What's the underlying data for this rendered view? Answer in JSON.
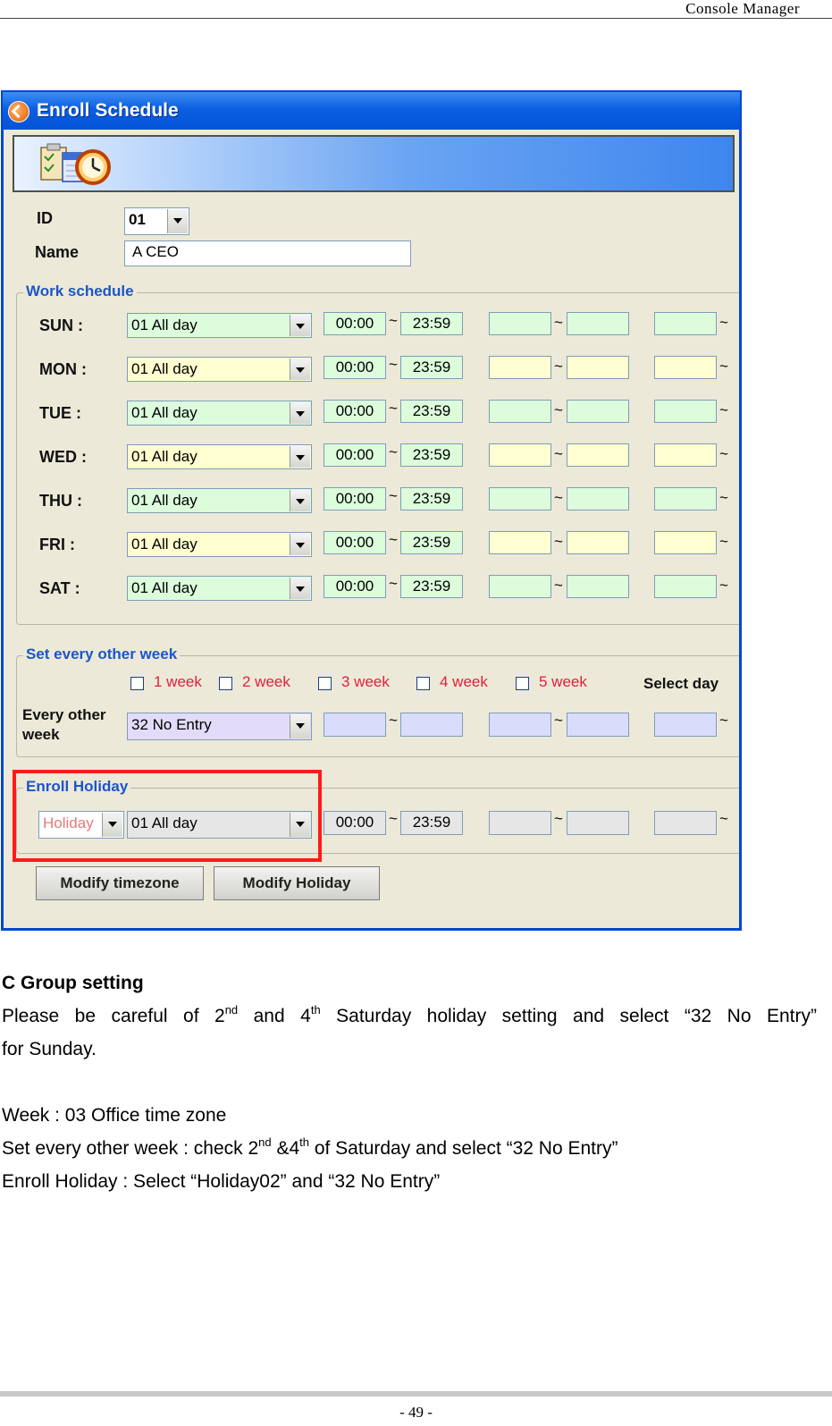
{
  "page_header": "Console Manager",
  "page_number": "- 49 -",
  "window": {
    "title": "Enroll Schedule",
    "id_label": "ID",
    "id_value": "01",
    "name_label": "Name",
    "name_value": "A CEO",
    "work_schedule": {
      "title": "Work schedule",
      "rows": [
        {
          "day": "SUN :",
          "zone": "01 All day",
          "start": "00:00",
          "end": "23:59"
        },
        {
          "day": "MON :",
          "zone": "01 All day",
          "start": "00:00",
          "end": "23:59"
        },
        {
          "day": "TUE :",
          "zone": "01 All day",
          "start": "00:00",
          "end": "23:59"
        },
        {
          "day": "WED :",
          "zone": "01 All day",
          "start": "00:00",
          "end": "23:59"
        },
        {
          "day": "THU :",
          "zone": "01 All day",
          "start": "00:00",
          "end": "23:59"
        },
        {
          "day": "FRI :",
          "zone": "01 All day",
          "start": "00:00",
          "end": "23:59"
        },
        {
          "day": "SAT :",
          "zone": "01 All day",
          "start": "00:00",
          "end": "23:59"
        }
      ],
      "tilde": "~"
    },
    "other_week": {
      "title": "Set every other week",
      "weeks": [
        "1 week",
        "2 week",
        "3 week",
        "4 week",
        "5 week"
      ],
      "select_day": "Select day",
      "label_line1": "Every other",
      "label_line2": "week",
      "zone": "32 No Entry"
    },
    "holiday": {
      "title": "Enroll Holiday",
      "holiday_value": "Holiday",
      "zone": "01 All day",
      "start": "00:00",
      "end": "23:59"
    },
    "buttons": {
      "modify_timezone": "Modify timezone",
      "modify_holiday": "Modify Holiday"
    }
  },
  "text": {
    "heading": "C Group setting",
    "p1_a": "Please be careful of 2",
    "p1_sup1": "nd",
    "p1_b": " and 4",
    "p1_sup2": "th",
    "p1_c": " Saturday holiday setting and select “32 No Entry”",
    "p1_d": "for Sunday.",
    "week_line": "Week : 03 Office time zone",
    "other_a": "Set every other week : check 2",
    "other_sup1": "nd",
    "other_b": " &4",
    "other_sup2": "th",
    "other_c": " of Saturday and select “32 No Entry”",
    "holiday_line": "Enroll Holiday : Select “Holiday02” and “32 No Entry”"
  }
}
